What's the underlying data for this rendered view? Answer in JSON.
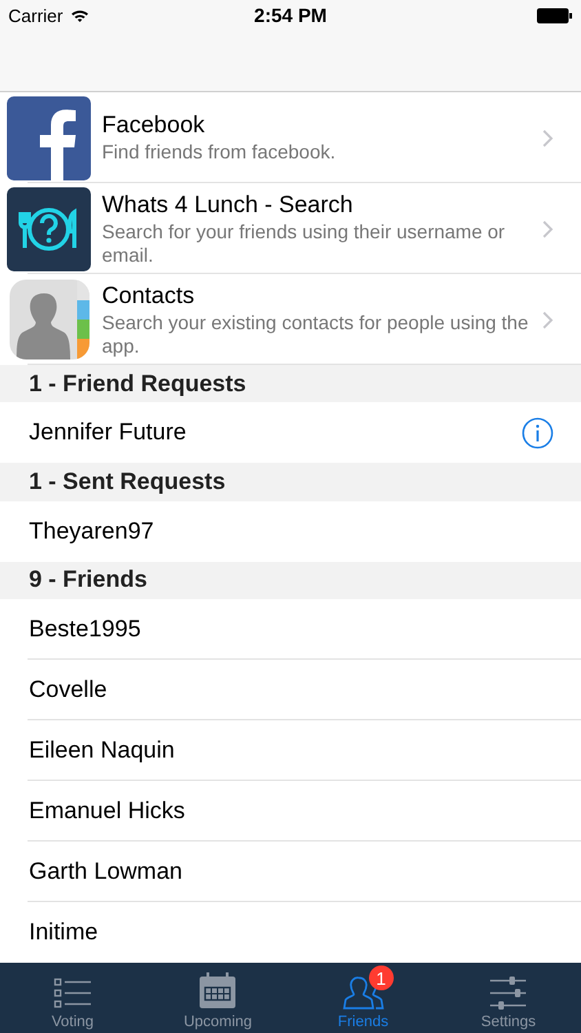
{
  "status_bar": {
    "carrier": "Carrier",
    "time": "2:54 PM"
  },
  "find_options": [
    {
      "kind": "facebook",
      "title": "Facebook",
      "subtitle": "Find friends from facebook."
    },
    {
      "kind": "app",
      "title": "Whats 4 Lunch - Search",
      "subtitle": "Search for your friends using their username or email."
    },
    {
      "kind": "contacts",
      "title": "Contacts",
      "subtitle": "Search your existing contacts for people using the app."
    }
  ],
  "sections": [
    {
      "header": "1 - Friend Requests",
      "rows": [
        {
          "name": "Jennifer Future",
          "info": true
        }
      ]
    },
    {
      "header": "1 - Sent Requests",
      "rows": [
        {
          "name": "Theyaren97",
          "info": false
        }
      ]
    },
    {
      "header": "9 - Friends",
      "rows": [
        {
          "name": "Beste1995",
          "info": false
        },
        {
          "name": "Covelle",
          "info": false
        },
        {
          "name": "Eileen Naquin",
          "info": false
        },
        {
          "name": "Emanuel Hicks",
          "info": false
        },
        {
          "name": "Garth Lowman",
          "info": false
        },
        {
          "name": "Initime",
          "info": false
        }
      ]
    }
  ],
  "tab_bar": [
    {
      "kind": "voting",
      "label": "Voting",
      "selected": false
    },
    {
      "kind": "upcoming",
      "label": "Upcoming",
      "selected": false
    },
    {
      "kind": "friends",
      "label": "Friends",
      "selected": true,
      "badge": "1"
    },
    {
      "kind": "settings",
      "label": "Settings",
      "selected": false
    }
  ]
}
